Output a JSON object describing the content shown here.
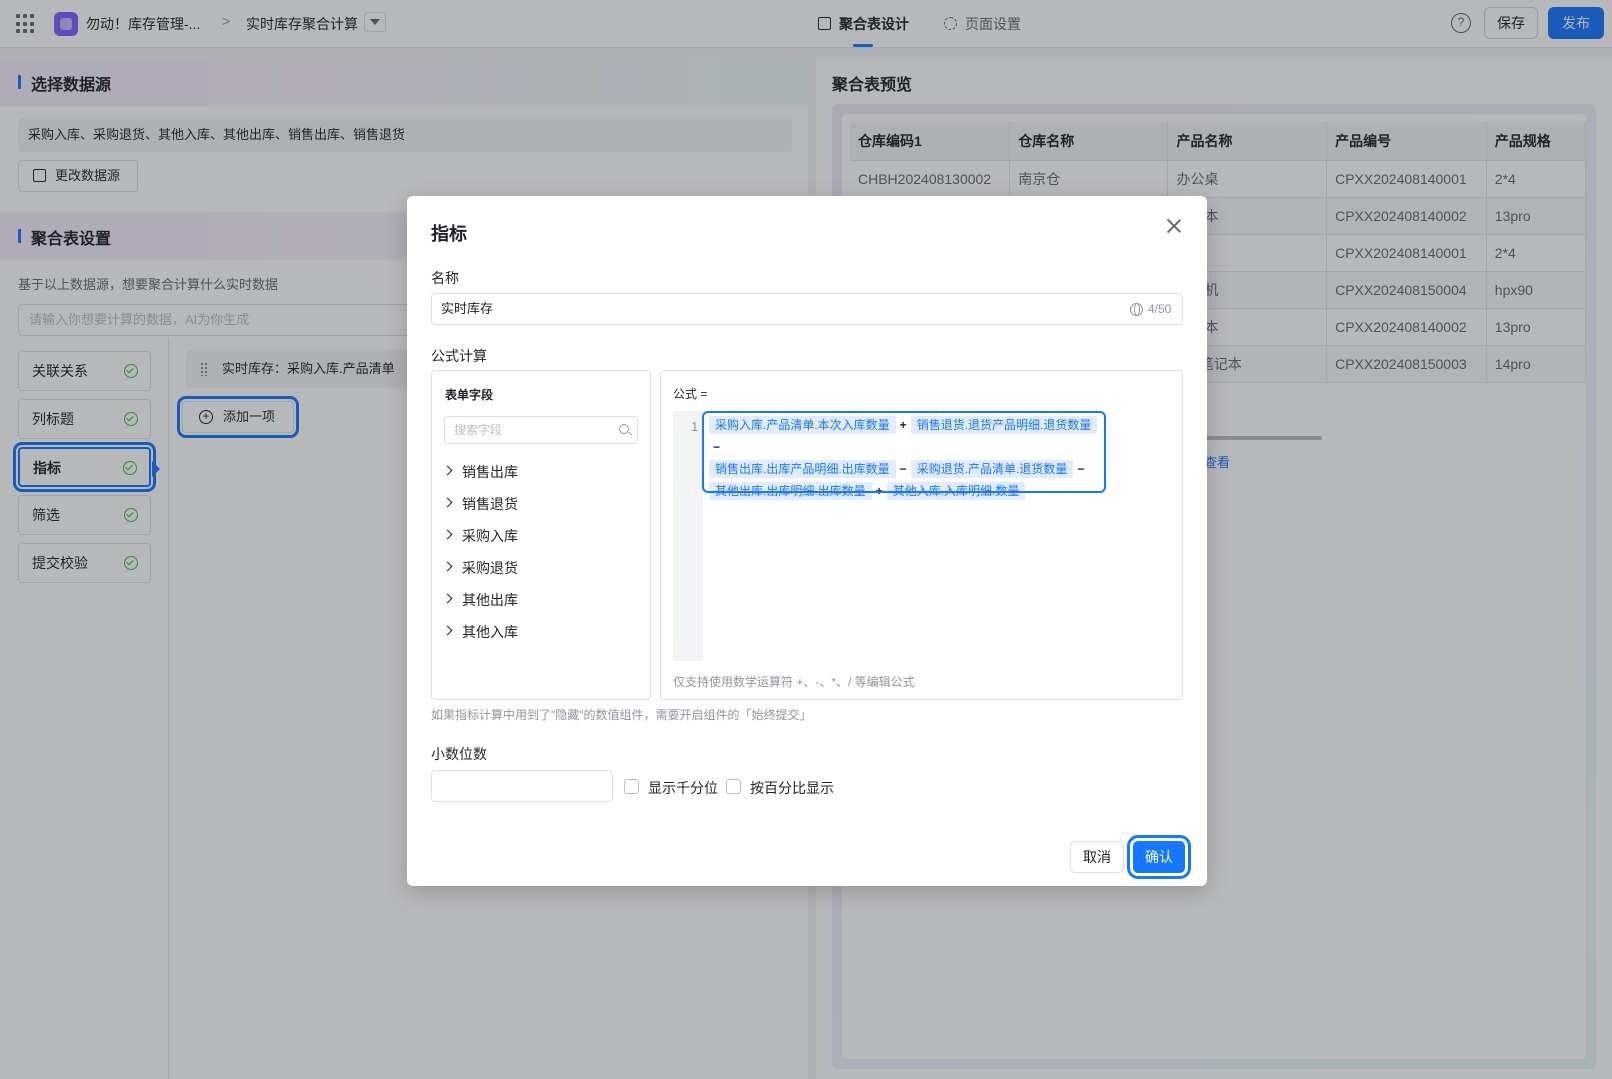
{
  "header": {
    "app_name": "勿动！库存管理-...",
    "breadcrumb_separator": ">",
    "page_name": "实时库存聚合计算",
    "tabs": [
      {
        "label": "聚合表设计",
        "active": true
      },
      {
        "label": "页面设置",
        "active": false
      }
    ],
    "help_label": "?",
    "save_label": "保存",
    "publish_label": "发布"
  },
  "left": {
    "datasource_title": "选择数据源",
    "datasource_value": "采购入库、采购退货、其他入库、其他出库、销售出库、销售退货",
    "change_datasource_label": "更改数据源",
    "settings_title": "聚合表设置",
    "hint": "基于以上数据源，想要聚合计算什么实时数据",
    "ai_placeholder": "请输入你想要计算的数据，AI为你生成",
    "steps": [
      {
        "label": "关联关系",
        "done": true
      },
      {
        "label": "列标题",
        "done": true
      },
      {
        "label": "指标",
        "done": true,
        "active": true
      },
      {
        "label": "筛选",
        "done": true
      },
      {
        "label": "提交校验",
        "done": true
      }
    ],
    "metric_item": "实时库存：采购入库.产品清单",
    "add_item_label": "添加一项"
  },
  "preview": {
    "title": "聚合表预览",
    "columns": [
      "仓库编码1",
      "仓库名称",
      "产品名称",
      "产品编号",
      "产品规格"
    ],
    "rows": [
      [
        "CHBH202408130002",
        "南京仓",
        "办公桌",
        "CPXX202408140001",
        "2*4"
      ],
      [
        "",
        "",
        "笔记本",
        "CPXX202408140002",
        "13pro"
      ],
      [
        "",
        "",
        "桌",
        "CPXX202408140001",
        "2*4"
      ],
      [
        "",
        "",
        "打印机",
        "CPXX202408150004",
        "hpx90"
      ],
      [
        "",
        "",
        "笔记本",
        "CPXX202408140002",
        "13pro"
      ],
      [
        "",
        "",
        "pad笔记本",
        "CPXX202408150003",
        "14pro"
      ]
    ],
    "view_link": "查看"
  },
  "modal": {
    "title": "指标",
    "name_label": "名称",
    "name_value": "实时库存",
    "name_counter": "4/50",
    "formula_section_label": "公式计算",
    "fields_title": "表单字段",
    "search_placeholder": "搜索字段",
    "field_groups": [
      "销售出库",
      "销售退货",
      "采购入库",
      "采购退货",
      "其他出库",
      "其他入库"
    ],
    "formula_title": "公式 =",
    "line_number": "1",
    "formula_tokens": [
      {
        "t": "field",
        "v": "采购入库.产品清单.本次入库数量"
      },
      {
        "t": "op",
        "v": "+"
      },
      {
        "t": "field",
        "v": "销售退货.退货产品明细.退货数量"
      },
      {
        "t": "op",
        "v": "−"
      },
      {
        "t": "field",
        "v": "销售出库.出库产品明细.出库数量"
      },
      {
        "t": "op",
        "v": "−"
      },
      {
        "t": "field",
        "v": "采购退货.产品清单.退货数量"
      },
      {
        "t": "op",
        "v": "−"
      },
      {
        "t": "field",
        "v": "其他出库.出库明细.出库数量"
      },
      {
        "t": "op",
        "v": "+"
      },
      {
        "t": "field",
        "v": "其他入库.入库明细.数量"
      }
    ],
    "formula_hint": "仅支持使用数学运算符 +、-、*、/ 等编辑公式",
    "formula_note": "如果指标计算中用到了\"隐藏\"的数值组件，需要开启组件的「始终提交」",
    "decimal_label": "小数位数",
    "decimal_value": "",
    "thousands_label": "显示千分位",
    "percent_label": "按百分比显示",
    "cancel_label": "取消",
    "confirm_label": "确认"
  },
  "colors": {
    "primary": "#1677ff",
    "success": "#34c724",
    "token_bg": "#e1ecff"
  }
}
